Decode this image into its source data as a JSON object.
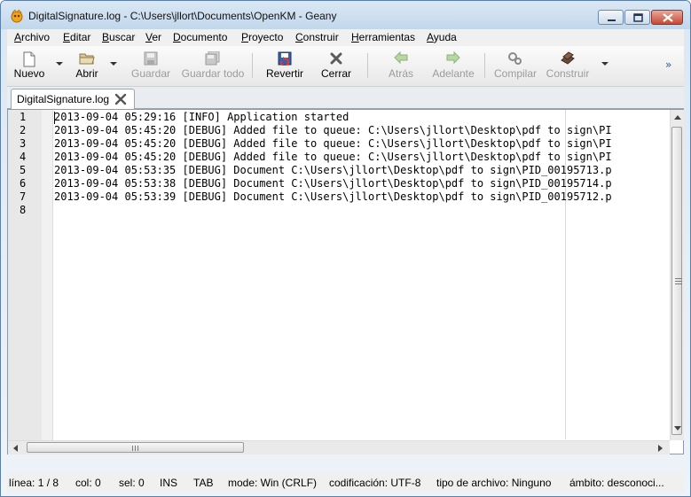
{
  "window": {
    "title": "DigitalSignature.log - C:\\Users\\jllort\\Documents\\OpenKM - Geany"
  },
  "menu": [
    {
      "u": "A",
      "rest": "rchivo"
    },
    {
      "u": "E",
      "rest": "ditar"
    },
    {
      "u": "B",
      "rest": "uscar"
    },
    {
      "u": "V",
      "rest": "er"
    },
    {
      "u": "D",
      "rest": "ocumento"
    },
    {
      "u": "P",
      "rest": "royecto"
    },
    {
      "u": "C",
      "rest": "onstruir"
    },
    {
      "u": "H",
      "rest": "erramientas"
    },
    {
      "u": "A",
      "rest": "yuda"
    }
  ],
  "toolbar": {
    "new": "Nuevo",
    "open": "Abrir",
    "save": "Guardar",
    "save_all": "Guardar todo",
    "revert": "Revertir",
    "close": "Cerrar",
    "back": "Atrás",
    "forward": "Adelante",
    "compile": "Compilar",
    "build": "Construir",
    "overflow": "»"
  },
  "tab": {
    "label": "DigitalSignature.log"
  },
  "editor": {
    "line_numbers": [
      "1",
      "2",
      "3",
      "4",
      "5",
      "6",
      "7",
      "8"
    ],
    "lines": [
      "2013-09-04 05:29:16 [INFO] Application started",
      "2013-09-04 05:45:20 [DEBUG] Added file to queue: C:\\Users\\jllort\\Desktop\\pdf to sign\\PI",
      "2013-09-04 05:45:20 [DEBUG] Added file to queue: C:\\Users\\jllort\\Desktop\\pdf to sign\\PI",
      "2013-09-04 05:45:20 [DEBUG] Added file to queue: C:\\Users\\jllort\\Desktop\\pdf to sign\\PI",
      "2013-09-04 05:53:35 [DEBUG] Document C:\\Users\\jllort\\Desktop\\pdf to sign\\PID_00195713.p",
      "2013-09-04 05:53:38 [DEBUG] Document C:\\Users\\jllort\\Desktop\\pdf to sign\\PID_00195714.p",
      "2013-09-04 05:53:39 [DEBUG] Document C:\\Users\\jllort\\Desktop\\pdf to sign\\PID_00195712.p",
      ""
    ],
    "hscroll_grip": "III"
  },
  "status": {
    "line": "línea: 1 / 8",
    "col": "col: 0",
    "sel": "sel: 0",
    "ins": "INS",
    "tab": "TAB",
    "mode": "mode: Win (CRLF)",
    "encoding": "codificación: UTF-8",
    "filetype": "tipo de archivo: Ninguno",
    "scope": "ámbito: desconoci..."
  },
  "colors": {
    "close_button": "#c64a35",
    "long_line_marker": "#c7e6c7"
  }
}
